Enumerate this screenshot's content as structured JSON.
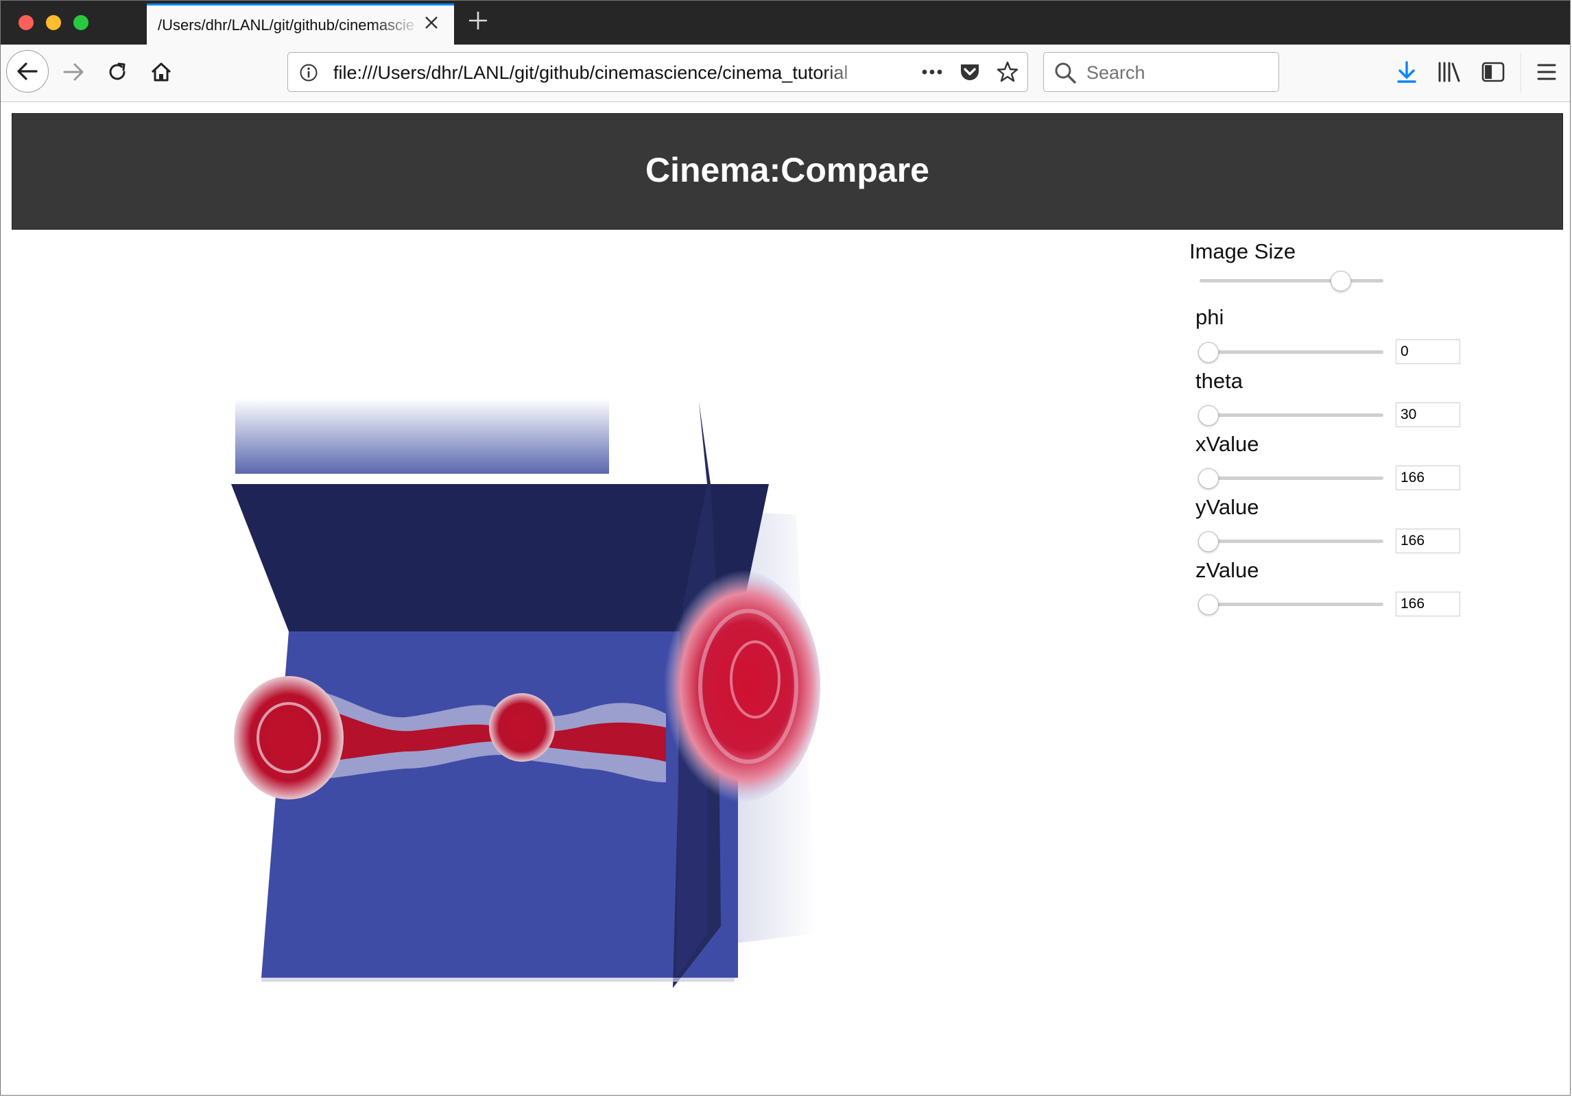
{
  "browser": {
    "tab_title": "/Users/dhr/LANL/git/github/cinemascience",
    "url": "file:///Users/dhr/LANL/git/github/cinemascience/cinema_tutorial",
    "search_placeholder": "Search",
    "colors": {
      "close": "#fe5f57",
      "minimize": "#febc2e",
      "maximize": "#28c840",
      "accent": "#0a84ff"
    },
    "icons": [
      "back-arrow-icon",
      "forward-arrow-icon",
      "reload-icon",
      "home-icon",
      "info-icon",
      "more-dots-icon",
      "pocket-icon",
      "bookmark-star-icon",
      "search-icon",
      "download-icon",
      "library-icon",
      "sidebar-icon",
      "menu-icon"
    ]
  },
  "page": {
    "title": "Cinema:Compare",
    "header_color": "#383838"
  },
  "controls": {
    "image_size": {
      "label": "Image Size",
      "fraction": 0.77
    },
    "sliders": [
      {
        "id": "phi",
        "label": "phi",
        "value": "0",
        "fraction": 0.0
      },
      {
        "id": "theta",
        "label": "theta",
        "value": "30",
        "fraction": 0.0
      },
      {
        "id": "xValue",
        "label": "xValue",
        "value": "166",
        "fraction": 0.0
      },
      {
        "id": "yValue",
        "label": "yValue",
        "value": "166",
        "fraction": 0.0
      },
      {
        "id": "zValue",
        "label": "zValue",
        "value": "166",
        "fraction": 0.0
      }
    ]
  }
}
